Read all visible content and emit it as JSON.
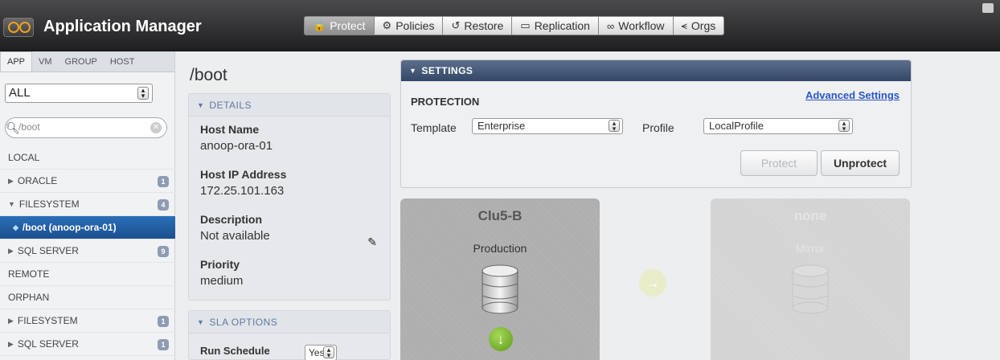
{
  "app": {
    "title": "Application Manager"
  },
  "nav": [
    {
      "label": "Protect",
      "icon": "lock-icon",
      "glyph": "🔒"
    },
    {
      "label": "Policies",
      "icon": "gear-icon",
      "glyph": "⚙"
    },
    {
      "label": "Restore",
      "icon": "restore-icon",
      "glyph": "↺"
    },
    {
      "label": "Replication",
      "icon": "replication-icon",
      "glyph": "▭"
    },
    {
      "label": "Workflow",
      "icon": "workflow-icon",
      "glyph": "∞"
    },
    {
      "label": "Orgs",
      "icon": "orgs-icon",
      "glyph": "⪪"
    }
  ],
  "sidebar": {
    "tabs": [
      "APP",
      "VM",
      "GROUP",
      "HOST"
    ],
    "filter_value": "ALL",
    "search_value": "/boot",
    "items": [
      {
        "label": "LOCAL",
        "arrow": "",
        "badge": ""
      },
      {
        "label": "ORACLE",
        "arrow": "▶",
        "badge": "1"
      },
      {
        "label": "FILESYSTEM",
        "arrow": "▼",
        "badge": "4"
      },
      {
        "label": "/boot (anoop-ora-01)",
        "arrow": "◆",
        "badge": ""
      },
      {
        "label": "SQL SERVER",
        "arrow": "▶",
        "badge": "9"
      },
      {
        "label": "REMOTE",
        "arrow": "",
        "badge": ""
      },
      {
        "label": "ORPHAN",
        "arrow": "",
        "badge": ""
      },
      {
        "label": "FILESYSTEM",
        "arrow": "▶",
        "badge": "1"
      },
      {
        "label": "SQL SERVER",
        "arrow": "▶",
        "badge": "1"
      }
    ]
  },
  "details": {
    "page_title": "/boot",
    "header": "DETAILS",
    "host_name_label": "Host Name",
    "host_name": "anoop-ora-01",
    "host_ip_label": "Host IP Address",
    "host_ip": "172.25.101.163",
    "description_label": "Description",
    "description": "Not available",
    "priority_label": "Priority",
    "priority": "medium"
  },
  "sla": {
    "header": "SLA OPTIONS",
    "run_schedule_label": "Run Schedule",
    "run_schedule_value": "Yes"
  },
  "settings": {
    "header": "SETTINGS",
    "protection_label": "PROTECTION",
    "advanced_link": "Advanced Settings",
    "template_label": "Template",
    "template_value": "Enterprise",
    "profile_label": "Profile",
    "profile_value": "LocalProfile",
    "protect_button": "Protect",
    "unprotect_button": "Unprotect"
  },
  "cards": {
    "left_title": "Clu5-B",
    "left_sub": "Production",
    "right_title": "none",
    "right_sub": "Mirror"
  }
}
